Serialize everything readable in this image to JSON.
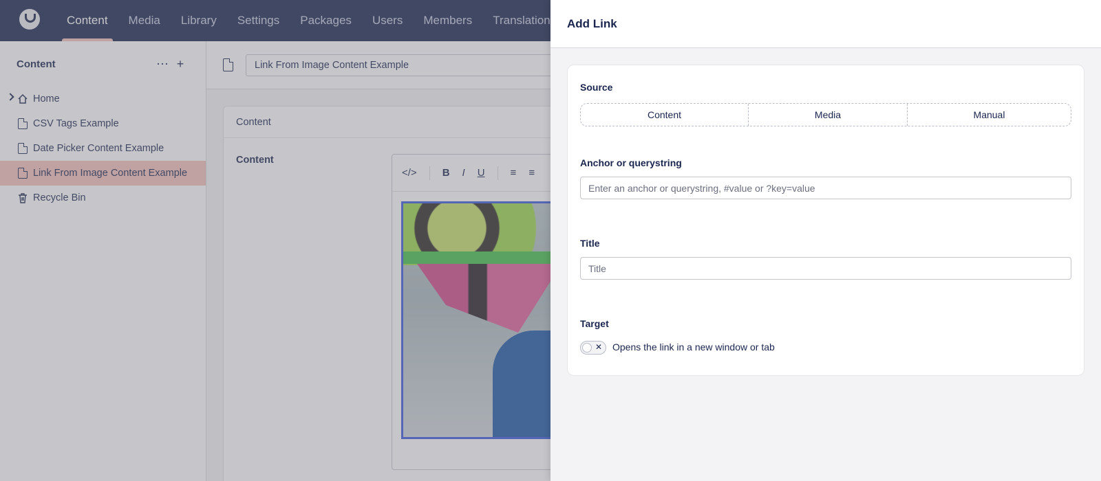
{
  "topnav": {
    "logo_icon": "umbraco-logo-icon",
    "items": [
      "Content",
      "Media",
      "Library",
      "Settings",
      "Packages",
      "Users",
      "Members",
      "Translation"
    ],
    "active_index": 0
  },
  "sidebar": {
    "title": "Content",
    "actions": {
      "more_icon": "ellipsis-icon",
      "add_icon": "plus-icon"
    },
    "items": [
      {
        "label": "Home",
        "icon": "home-icon",
        "expandable": true
      },
      {
        "label": "CSV Tags Example",
        "icon": "document-icon"
      },
      {
        "label": "Date Picker Content Example",
        "icon": "document-icon"
      },
      {
        "label": "Link From Image Content Example",
        "icon": "document-icon",
        "active": true
      },
      {
        "label": "Recycle Bin",
        "icon": "trash-icon"
      }
    ]
  },
  "editor": {
    "document_name": "Link From Image Content Example",
    "tab_label": "Content",
    "property_label": "Content",
    "toolbar_icons": [
      "code-icon",
      "bold-icon",
      "italic-icon",
      "underline-icon",
      "align-left-icon",
      "align-center-icon"
    ]
  },
  "modal": {
    "title": "Add Link",
    "source": {
      "label": "Source",
      "options": [
        "Content",
        "Media",
        "Manual"
      ]
    },
    "anchor": {
      "label": "Anchor or querystring",
      "placeholder": "Enter an anchor or querystring, #value or ?key=value",
      "value": ""
    },
    "title_field": {
      "label": "Title",
      "placeholder": "Title",
      "value": ""
    },
    "target": {
      "label": "Target",
      "toggle_checked": false,
      "toggle_text": "Opens the link in a new window or tab"
    }
  },
  "colors": {
    "header_bg": "#1b264f",
    "active_accent": "#f5c1bc",
    "text_primary": "#1b264f",
    "image_border": "#3b5bdb"
  }
}
